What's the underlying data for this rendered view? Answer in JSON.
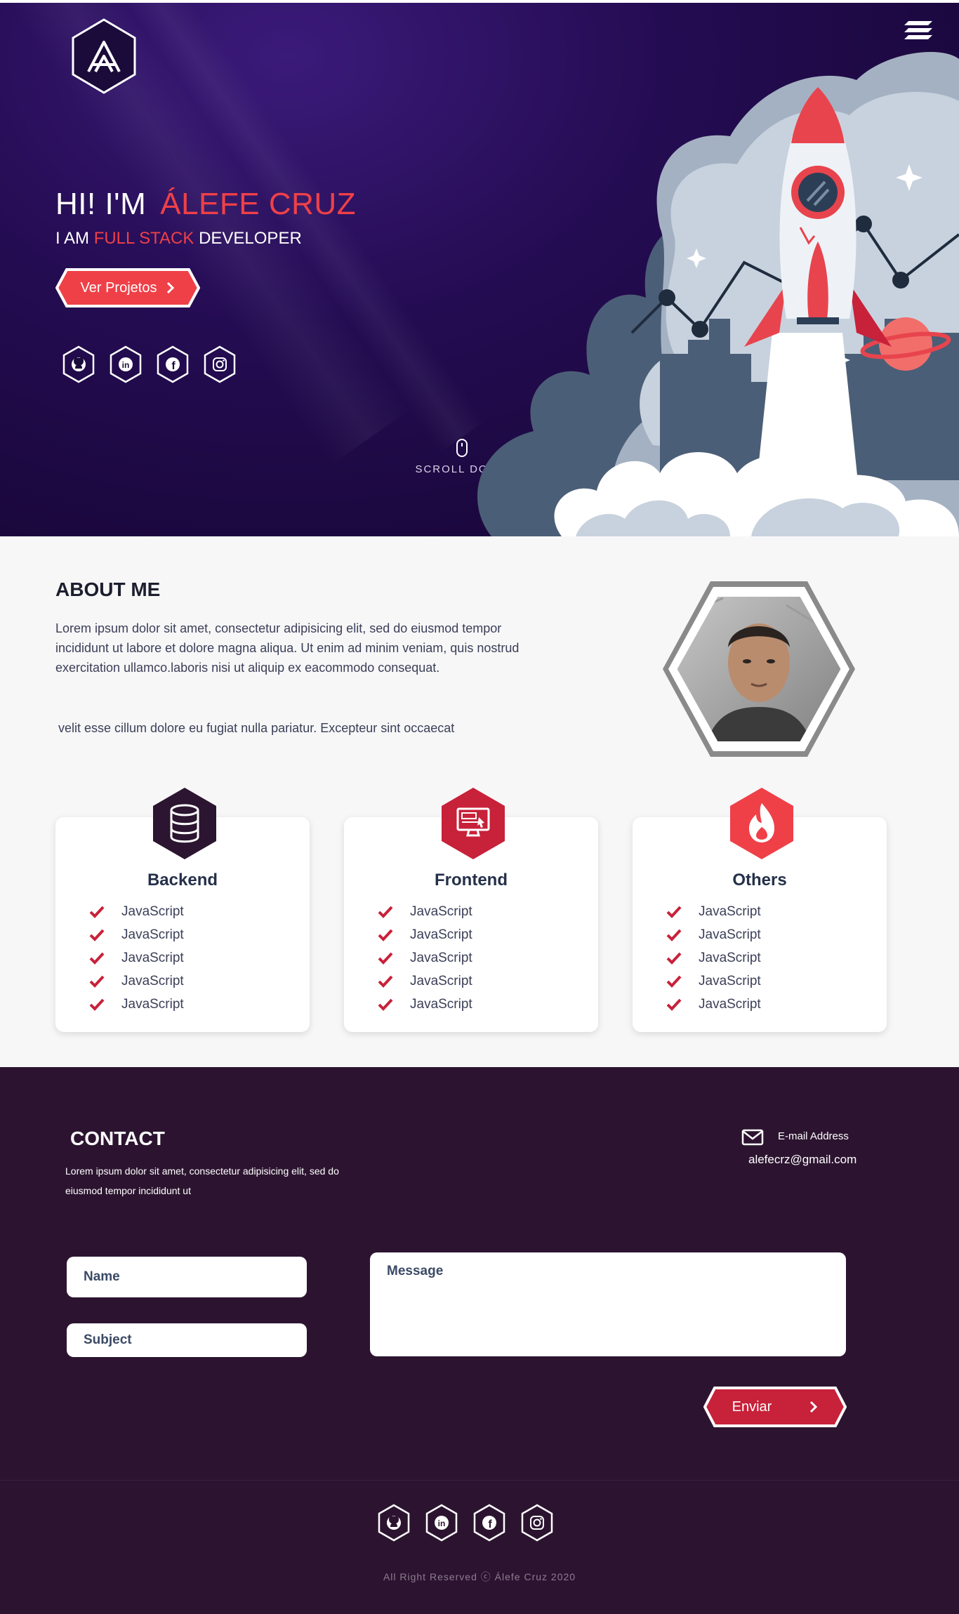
{
  "hero": {
    "greeting": "HI! I'M",
    "name": "ÁLEFE CRUZ",
    "sub_prefix": "I AM",
    "sub_accent": "FULL STACK",
    "sub_suffix": "DEVELOPER",
    "cta_label": "Ver Projetos",
    "scroll_label": "SCROLL DOWN"
  },
  "about": {
    "title": "ABOUT ME",
    "paragraph1": "Lorem ipsum dolor sit amet, consectetur adipisicing elit, sed do eiusmod tempor incididunt ut labore et dolore magna aliqua. Ut enim ad minim veniam, quis nostrud exercitation ullamco.laboris nisi ut aliquip ex eacommodo consequat.",
    "paragraph2": "velit esse cillum dolore eu fugiat nulla pariatur. Excepteur sint occaecat"
  },
  "skills": [
    {
      "title": "Backend",
      "icon": "database-icon",
      "items": [
        "JavaScript",
        "JavaScript",
        "JavaScript",
        "JavaScript",
        "JavaScript"
      ]
    },
    {
      "title": "Frontend",
      "icon": "monitor-icon",
      "items": [
        "JavaScript",
        "JavaScript",
        "JavaScript",
        "JavaScript",
        "JavaScript"
      ]
    },
    {
      "title": "Others",
      "icon": "fire-icon",
      "items": [
        "JavaScript",
        "JavaScript",
        "JavaScript",
        "JavaScript",
        "JavaScript"
      ]
    }
  ],
  "contact": {
    "title": "CONTACT",
    "description": "Lorem ipsum dolor sit amet, consectetur adipisicing elit, sed do eiusmod tempor incididunt ut",
    "email_label": "E-mail Address",
    "email_value": "alefecrz@gmail.com",
    "name_placeholder": "Name",
    "subject_placeholder": "Subject",
    "message_placeholder": "Message",
    "send_label": "Enviar"
  },
  "footer": {
    "copyright": "All Right Reserved  ⓒ  Álefe Cruz 2020"
  },
  "social_icons": [
    "github-icon",
    "linkedin-icon",
    "facebook-icon",
    "instagram-icon"
  ],
  "colors": {
    "accent": "#ef4048",
    "accent_dark": "#c8213a",
    "hero_bg": "#240c52",
    "contact_bg": "#2c1430",
    "card_badge_backend": "#2b1530"
  }
}
